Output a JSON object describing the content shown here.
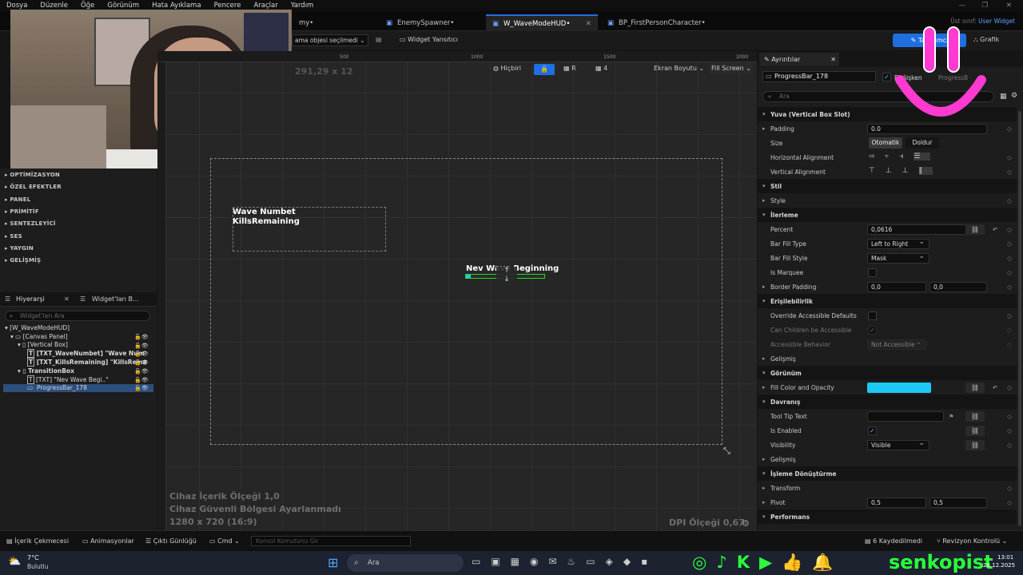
{
  "menu": [
    "Dosya",
    "Düzenle",
    "Öğe",
    "Görünüm",
    "Hata Ayıklama",
    "Pencere",
    "Araçlar",
    "Yardım"
  ],
  "tabs": [
    {
      "label": "my•"
    },
    {
      "label": "EnemySpawner•"
    },
    {
      "label": "W_WaveModeHUD•"
    },
    {
      "label": "BP_FirstPersonCharacter•"
    }
  ],
  "parent_class": {
    "label": "Üst sınıf:",
    "value": "User Widget"
  },
  "toolbar": {
    "select_label": "ama objesi seçilmedi",
    "reflector": "Widget Yansıtıcı",
    "designer": "Tasarımcı",
    "graph": "Grafik",
    "none_label": "Hiçbiri",
    "r_label": "R",
    "grid_value": "4",
    "screen_size": "Ekran Boyutu",
    "fill_screen": "Fill Screen"
  },
  "ruler": {
    "marks": [
      "500",
      "1000",
      "1500",
      "2000"
    ]
  },
  "viewport": {
    "size_readout": "291,29 x 12",
    "text_block_1": "Wave Numbet",
    "text_block_2": "KillsRemaining",
    "transition_text": "Nev Wave Beginning",
    "device_scale": "Cihaz İçerik Ölçeği 1,0",
    "safe_zone": "Cihaz Güvenli Bölgesi Ayarlanmadı",
    "resolution": "1280 x 720 (16:9)",
    "dpi": "DPI Ölçeği 0,67"
  },
  "palette_categories": [
    "OPTİMİZASYON",
    "ÖZEL EFEKTLER",
    "PANEL",
    "PRİMİTİF",
    "SENTEZLEYİCİ",
    "SES",
    "YAYGIN",
    "GELİŞMİŞ"
  ],
  "hierarchy": {
    "tab1": "Hiyerarşi",
    "tab2": "Widget'ları B...",
    "search_placeholder": "Widget'ları Ara",
    "items": [
      "[W_WaveModeHUD]",
      "[Canvas Panel]",
      "[Vertical Box]",
      "[TXT_WaveNumbet] \"Wave Num",
      "[TXT_KillsRemaining] \"KillsRema",
      "TransitionBox",
      "[TXT] \"Nev Wave Begi..\"",
      "ProgressBar_178"
    ]
  },
  "details": {
    "tab": "Ayrıntılar",
    "widget_name": "ProgressBar_178",
    "is_variable": "Değişken",
    "class_hint": "ProgressB",
    "search_placeholder": "Ara",
    "rows": [
      {
        "type": "section",
        "label": "Yuva (Vertical Box Slot)"
      },
      {
        "type": "prop",
        "label": "Padding",
        "value": "0.0"
      },
      {
        "type": "prop",
        "label": "Size",
        "value": "Otomatik",
        "value2": "Doldur"
      },
      {
        "type": "prop",
        "label": "Horizontal Alignment"
      },
      {
        "type": "prop",
        "label": "Vertical Alignment"
      },
      {
        "type": "section",
        "label": "Stil"
      },
      {
        "type": "prop",
        "label": "Style"
      },
      {
        "type": "section",
        "label": "İlerleme"
      },
      {
        "type": "prop",
        "label": "Percent",
        "value": "0,0616"
      },
      {
        "type": "prop",
        "label": "Bar Fill Type",
        "value": "Left to Right"
      },
      {
        "type": "prop",
        "label": "Bar Fill Style",
        "value": "Mask"
      },
      {
        "type": "prop",
        "label": "Is Marquee"
      },
      {
        "type": "prop",
        "label": "Border Padding",
        "value": "0,0",
        "value2": "0,0"
      },
      {
        "type": "section",
        "label": "Erişilebilirlik"
      },
      {
        "type": "prop",
        "label": "Override Accessible Defaults"
      },
      {
        "type": "prop",
        "label": "Can Children be Accessible"
      },
      {
        "type": "prop",
        "label": "Accessible Behavior",
        "value": "Not Accessible"
      },
      {
        "type": "prop",
        "label": "Gelişmiş"
      },
      {
        "type": "section",
        "label": "Görünüm"
      },
      {
        "type": "prop",
        "label": "Fill Color and Opacity"
      },
      {
        "type": "section",
        "label": "Davranış"
      },
      {
        "type": "prop",
        "label": "Tool Tip Text"
      },
      {
        "type": "prop",
        "label": "Is Enabled"
      },
      {
        "type": "prop",
        "label": "Visibility",
        "value": "Visible"
      },
      {
        "type": "prop",
        "label": "Gelişmiş"
      },
      {
        "type": "section",
        "label": "İşleme Dönüştürme"
      },
      {
        "type": "prop",
        "label": "Transform"
      },
      {
        "type": "prop",
        "label": "Pivot",
        "value": "0,5",
        "value2": "0,5"
      },
      {
        "type": "section",
        "label": "Performans"
      }
    ]
  },
  "colors": {
    "fill_color": "#1ec8f5",
    "accent": "#1f6fe0",
    "selection_green": "#2fd02f"
  },
  "statusbar": {
    "content_drawer": "İçerik Çekmecesi",
    "animations": "Animasyonlar",
    "output_log": "Çıktı Günlüğü",
    "cmd": "Cmd",
    "console_placeholder": "Konsol Komutunu Gir",
    "saved": "6 Kaydedilmedi",
    "revision": "Revizyon Kontrolü"
  },
  "taskbar": {
    "temp": "7°C",
    "weather": "Bulutlu",
    "search": "Ara",
    "time": "13:01",
    "date": "28.12.2025"
  },
  "overlay": {
    "brand": "senkopist"
  }
}
